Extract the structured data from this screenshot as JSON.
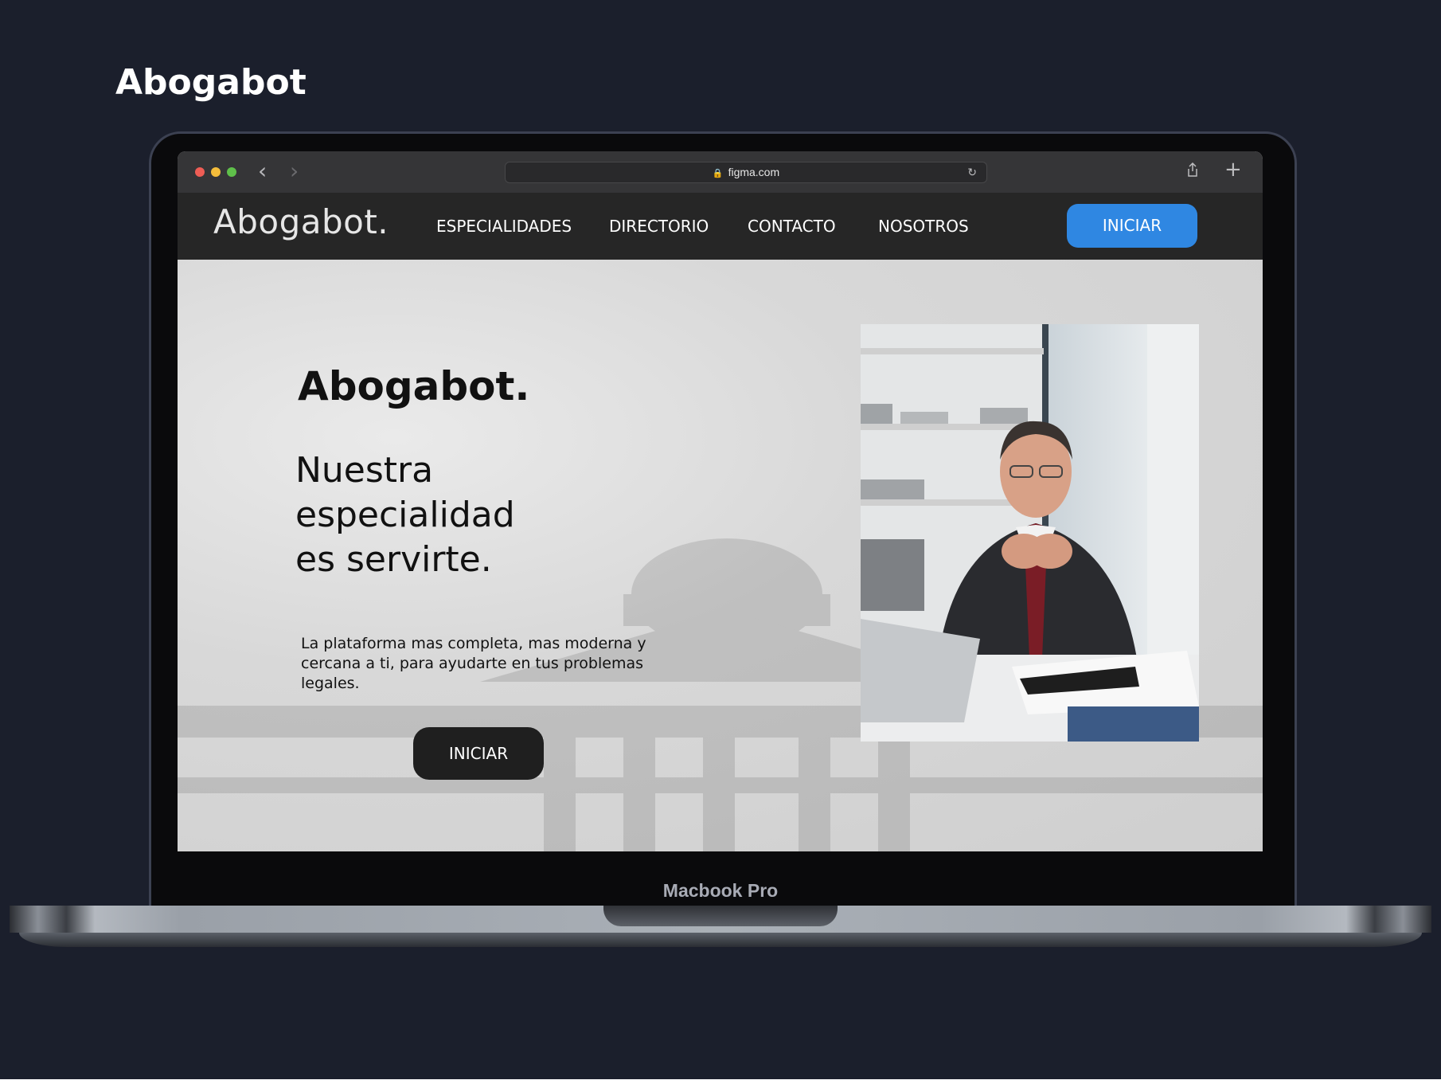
{
  "page": {
    "title": "Abogabot"
  },
  "device": {
    "name": "Macbook Pro"
  },
  "browser": {
    "url": "figma.com",
    "back_icon": "chevron-left-icon",
    "forward_icon": "chevron-right-icon"
  },
  "site": {
    "logo": "Abogabot.",
    "nav": [
      {
        "label": "ESPECIALIDADES"
      },
      {
        "label": "DIRECTORIO"
      },
      {
        "label": "CONTACTO"
      },
      {
        "label": "NOSOTROS"
      }
    ],
    "header_cta": "INICIAR",
    "hero": {
      "logo": "Abogabot.",
      "tagline": "Nuestra especialidad es servirte.",
      "description": "La plataforma mas completa, mas moderna y cercana a ti, para ayudarte en tus problemas legales.",
      "cta": "INICIAR"
    }
  },
  "colors": {
    "page_bg": "#1b1f2c",
    "header_bg": "#262626",
    "accent": "#2f87e2",
    "hero_button": "#1f1f1f"
  }
}
